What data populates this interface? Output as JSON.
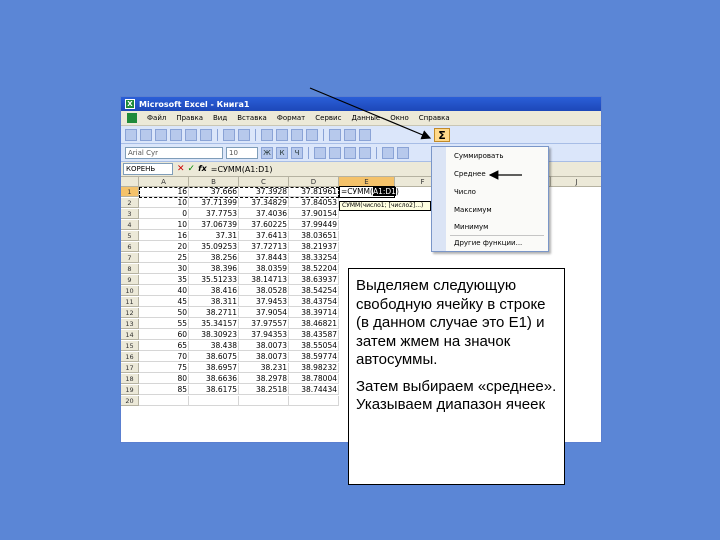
{
  "window": {
    "title": "Microsoft Excel - Книга1"
  },
  "menu": {
    "items": [
      "Файл",
      "Правка",
      "Вид",
      "Вставка",
      "Формат",
      "Сервис",
      "Данные",
      "Окно",
      "Справка"
    ]
  },
  "toolbar2": {
    "font": "Arial Cyr",
    "size": "10"
  },
  "formula_bar": {
    "name_box": "КОРЕНЬ",
    "formula": "=СУММ(A1:D1)"
  },
  "columns": [
    "A",
    "B",
    "C",
    "D",
    "E",
    "F",
    "J"
  ],
  "rows": [
    {
      "n": "1",
      "a": "16",
      "b": "37.666",
      "c": "37.3928",
      "d": "37.81961"
    },
    {
      "n": "2",
      "a": "10",
      "b": "37.71399",
      "c": "37.34829",
      "d": "37.84053"
    },
    {
      "n": "3",
      "a": "0",
      "b": "37.7753",
      "c": "37.4036",
      "d": "37.90154"
    },
    {
      "n": "4",
      "a": "10",
      "b": "37.06739",
      "c": "37.60225",
      "d": "37.99449"
    },
    {
      "n": "5",
      "a": "16",
      "b": "37.31",
      "c": "37.6413",
      "d": "38.03651"
    },
    {
      "n": "6",
      "a": "20",
      "b": "35.09253",
      "c": "37.72713",
      "d": "38.21937"
    },
    {
      "n": "7",
      "a": "25",
      "b": "38.256",
      "c": "37.8443",
      "d": "38.33254"
    },
    {
      "n": "8",
      "a": "30",
      "b": "38.396",
      "c": "38.0359",
      "d": "38.52204"
    },
    {
      "n": "9",
      "a": "35",
      "b": "35.51233",
      "c": "38.14713",
      "d": "38.63937"
    },
    {
      "n": "10",
      "a": "40",
      "b": "38.416",
      "c": "38.0528",
      "d": "38.54254"
    },
    {
      "n": "11",
      "a": "45",
      "b": "38.311",
      "c": "37.9453",
      "d": "38.43754"
    },
    {
      "n": "12",
      "a": "50",
      "b": "38.2711",
      "c": "37.9054",
      "d": "38.39714"
    },
    {
      "n": "13",
      "a": "55",
      "b": "35.34157",
      "c": "37.97557",
      "d": "38.46821"
    },
    {
      "n": "14",
      "a": "60",
      "b": "38.30923",
      "c": "37.94353",
      "d": "38.43587"
    },
    {
      "n": "15",
      "a": "65",
      "b": "38.438",
      "c": "38.0073",
      "d": "38.55054"
    },
    {
      "n": "16",
      "a": "70",
      "b": "38.6075",
      "c": "38.0073",
      "d": "38.59774"
    },
    {
      "n": "17",
      "a": "75",
      "b": "38.6957",
      "c": "38.231",
      "d": "38.98232"
    },
    {
      "n": "18",
      "a": "80",
      "b": "38.6636",
      "c": "38.2978",
      "d": "38.78004"
    },
    {
      "n": "19",
      "a": "85",
      "b": "38.6175",
      "c": "38.2518",
      "d": "38.74434"
    },
    {
      "n": "20",
      "a": "",
      "b": "",
      "c": "",
      "d": ""
    }
  ],
  "edit": {
    "prefix": "=СУММ(",
    "range": "A1:D1",
    "suffix": ")"
  },
  "tooltip": "СУММ(число1; [число2]...)",
  "dropdown": {
    "items": [
      "Суммировать",
      "Среднее",
      "Число",
      "Максимум",
      "Минимум",
      "Другие функции..."
    ]
  },
  "note": {
    "p1": "Выделяем следующую свободную ячейку в строке (в данном случае это Е1) и затем жмем на значок автосуммы.",
    "p2": "Затем выбираем «среднее». Указываем диапазон ячеек"
  }
}
